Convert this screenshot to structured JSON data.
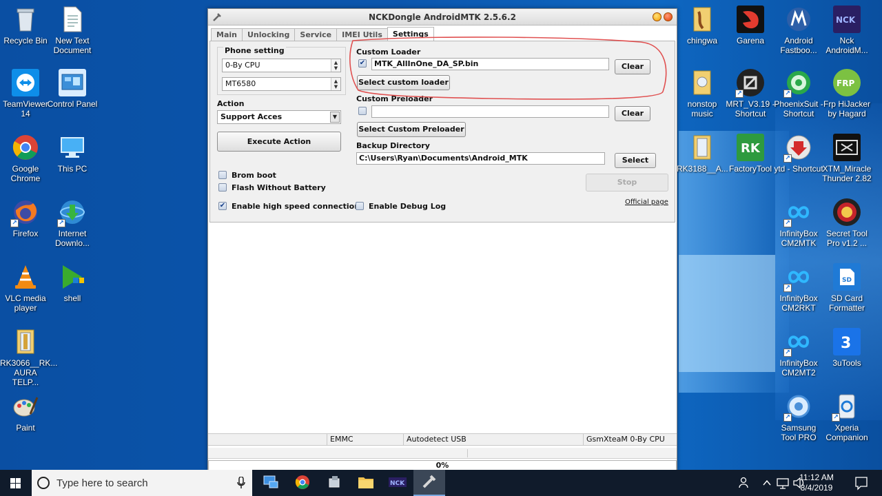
{
  "desktop": {
    "left_icons": [
      {
        "label": "Recycle Bin",
        "icon": "recycle-bin-icon"
      },
      {
        "label": "New Text Document",
        "icon": "text-document-icon"
      },
      {
        "label": "TeamViewer 14",
        "icon": "teamviewer-icon"
      },
      {
        "label": "Control Panel",
        "icon": "control-panel-icon"
      },
      {
        "label": "Google Chrome",
        "icon": "chrome-icon"
      },
      {
        "label": "This PC",
        "icon": "this-pc-icon"
      },
      {
        "label": "Firefox",
        "icon": "firefox-icon"
      },
      {
        "label": "Internet Downlo...",
        "icon": "internet-download-icon"
      },
      {
        "label": "VLC media player",
        "icon": "vlc-icon"
      },
      {
        "label": "shell",
        "icon": "shell-icon"
      },
      {
        "label": "RK3066__RK... AURA TELP...",
        "icon": "folder-icon"
      },
      {
        "label": "Paint",
        "icon": "paint-icon"
      }
    ],
    "right_icons": [
      {
        "label": "chingwa",
        "icon": "folder-icon"
      },
      {
        "label": "Garena",
        "icon": "garena-icon"
      },
      {
        "label": "Android Fastboo...",
        "icon": "motorola-icon"
      },
      {
        "label": "Nck AndroidM...",
        "icon": "nck-icon"
      },
      {
        "label": "nonstop music",
        "icon": "folder-icon"
      },
      {
        "label": "MRT_V3.19 - Shortcut",
        "icon": "mrt-icon"
      },
      {
        "label": "PhoenixSuit - Shortcut",
        "icon": "phoenixsuit-icon"
      },
      {
        "label": "Frp HiJacker by Hagard",
        "icon": "frp-icon"
      },
      {
        "label": "RK3188__A...",
        "icon": "folder-icon"
      },
      {
        "label": "FactoryTool",
        "icon": "factorytool-icon"
      },
      {
        "label": "ytd - Shortcut",
        "icon": "ytd-icon"
      },
      {
        "label": "XTM_Miracle Thunder 2.82",
        "icon": "xtm-icon"
      },
      {
        "label": "InfinityBox CM2MTK",
        "icon": "infinitybox-icon"
      },
      {
        "label": "Secret Tool Pro v1.2 ...",
        "icon": "secret-tool-icon"
      },
      {
        "label": "InfinityBox CM2RKT",
        "icon": "infinitybox-icon"
      },
      {
        "label": "SD Card Formatter",
        "icon": "sd-card-icon"
      },
      {
        "label": "InfinityBox CM2MT2",
        "icon": "infinitybox-icon"
      },
      {
        "label": "3uTools",
        "icon": "3utools-icon"
      },
      {
        "label": "Samsung Tool PRO",
        "icon": "samsung-tool-icon"
      },
      {
        "label": "Xperia Companion",
        "icon": "xperia-icon"
      }
    ]
  },
  "window": {
    "title": "NCKDongle AndroidMTK 2.5.6.2",
    "tabs": [
      "Main",
      "Unlocking",
      "Service",
      "IMEI Utils",
      "Settings"
    ],
    "active_tab": "Settings",
    "phone_setting": {
      "title": "Phone setting",
      "cpu": "0-By CPU",
      "model": "MT6580"
    },
    "action": {
      "label": "Action",
      "selected": "Support Acces",
      "execute_button": "Execute Action"
    },
    "options": {
      "brom_boot": "Brom boot",
      "flash_without_battery": "Flash Without Battery",
      "high_speed": "Enable high speed connection",
      "debug_log": "Enable Debug Log"
    },
    "custom_loader": {
      "label": "Custom Loader",
      "file": "MTK_AllInOne_DA_SP.bin",
      "clear_button": "Clear",
      "select_button": "Select custom loader"
    },
    "custom_preloader": {
      "label": "Custom Preloader",
      "file": "",
      "clear_button": "Clear",
      "select_button": "Select Custom Preloader"
    },
    "backup": {
      "label": "Backup Directory",
      "path": "C:\\Users\\Ryan\\Documents\\Android_MTK",
      "select_button": "Select"
    },
    "stop_button": "Stop",
    "official_page": "Official page",
    "status": {
      "storage": "EMMC",
      "detect": "Autodetect USB",
      "team": "GsmXteaM 0-By CPU"
    },
    "progress": "0%"
  },
  "taskbar": {
    "search_placeholder": "Type here to search",
    "time": "11:12 AM",
    "date": "8/4/2019"
  },
  "colors": {
    "annotation": "#e05050",
    "taskbar": "#101b2b",
    "desktop": "#0b56ad"
  }
}
